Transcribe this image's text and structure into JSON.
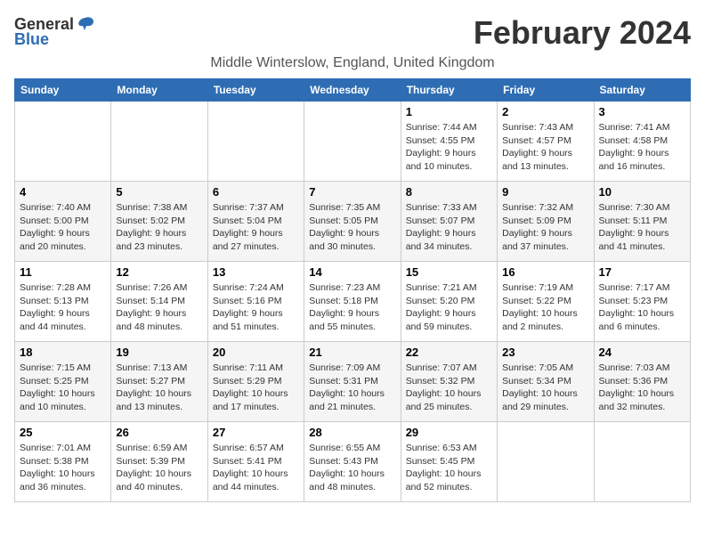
{
  "app": {
    "logo_general": "General",
    "logo_blue": "Blue"
  },
  "header": {
    "month_title": "February 2024",
    "location": "Middle Winterslow, England, United Kingdom"
  },
  "weekdays": [
    "Sunday",
    "Monday",
    "Tuesday",
    "Wednesday",
    "Thursday",
    "Friday",
    "Saturday"
  ],
  "weeks": [
    [
      {
        "day": "",
        "sunrise": "",
        "sunset": "",
        "daylight": ""
      },
      {
        "day": "",
        "sunrise": "",
        "sunset": "",
        "daylight": ""
      },
      {
        "day": "",
        "sunrise": "",
        "sunset": "",
        "daylight": ""
      },
      {
        "day": "",
        "sunrise": "",
        "sunset": "",
        "daylight": ""
      },
      {
        "day": "1",
        "sunrise": "Sunrise: 7:44 AM",
        "sunset": "Sunset: 4:55 PM",
        "daylight": "Daylight: 9 hours and 10 minutes."
      },
      {
        "day": "2",
        "sunrise": "Sunrise: 7:43 AM",
        "sunset": "Sunset: 4:57 PM",
        "daylight": "Daylight: 9 hours and 13 minutes."
      },
      {
        "day": "3",
        "sunrise": "Sunrise: 7:41 AM",
        "sunset": "Sunset: 4:58 PM",
        "daylight": "Daylight: 9 hours and 16 minutes."
      }
    ],
    [
      {
        "day": "4",
        "sunrise": "Sunrise: 7:40 AM",
        "sunset": "Sunset: 5:00 PM",
        "daylight": "Daylight: 9 hours and 20 minutes."
      },
      {
        "day": "5",
        "sunrise": "Sunrise: 7:38 AM",
        "sunset": "Sunset: 5:02 PM",
        "daylight": "Daylight: 9 hours and 23 minutes."
      },
      {
        "day": "6",
        "sunrise": "Sunrise: 7:37 AM",
        "sunset": "Sunset: 5:04 PM",
        "daylight": "Daylight: 9 hours and 27 minutes."
      },
      {
        "day": "7",
        "sunrise": "Sunrise: 7:35 AM",
        "sunset": "Sunset: 5:05 PM",
        "daylight": "Daylight: 9 hours and 30 minutes."
      },
      {
        "day": "8",
        "sunrise": "Sunrise: 7:33 AM",
        "sunset": "Sunset: 5:07 PM",
        "daylight": "Daylight: 9 hours and 34 minutes."
      },
      {
        "day": "9",
        "sunrise": "Sunrise: 7:32 AM",
        "sunset": "Sunset: 5:09 PM",
        "daylight": "Daylight: 9 hours and 37 minutes."
      },
      {
        "day": "10",
        "sunrise": "Sunrise: 7:30 AM",
        "sunset": "Sunset: 5:11 PM",
        "daylight": "Daylight: 9 hours and 41 minutes."
      }
    ],
    [
      {
        "day": "11",
        "sunrise": "Sunrise: 7:28 AM",
        "sunset": "Sunset: 5:13 PM",
        "daylight": "Daylight: 9 hours and 44 minutes."
      },
      {
        "day": "12",
        "sunrise": "Sunrise: 7:26 AM",
        "sunset": "Sunset: 5:14 PM",
        "daylight": "Daylight: 9 hours and 48 minutes."
      },
      {
        "day": "13",
        "sunrise": "Sunrise: 7:24 AM",
        "sunset": "Sunset: 5:16 PM",
        "daylight": "Daylight: 9 hours and 51 minutes."
      },
      {
        "day": "14",
        "sunrise": "Sunrise: 7:23 AM",
        "sunset": "Sunset: 5:18 PM",
        "daylight": "Daylight: 9 hours and 55 minutes."
      },
      {
        "day": "15",
        "sunrise": "Sunrise: 7:21 AM",
        "sunset": "Sunset: 5:20 PM",
        "daylight": "Daylight: 9 hours and 59 minutes."
      },
      {
        "day": "16",
        "sunrise": "Sunrise: 7:19 AM",
        "sunset": "Sunset: 5:22 PM",
        "daylight": "Daylight: 10 hours and 2 minutes."
      },
      {
        "day": "17",
        "sunrise": "Sunrise: 7:17 AM",
        "sunset": "Sunset: 5:23 PM",
        "daylight": "Daylight: 10 hours and 6 minutes."
      }
    ],
    [
      {
        "day": "18",
        "sunrise": "Sunrise: 7:15 AM",
        "sunset": "Sunset: 5:25 PM",
        "daylight": "Daylight: 10 hours and 10 minutes."
      },
      {
        "day": "19",
        "sunrise": "Sunrise: 7:13 AM",
        "sunset": "Sunset: 5:27 PM",
        "daylight": "Daylight: 10 hours and 13 minutes."
      },
      {
        "day": "20",
        "sunrise": "Sunrise: 7:11 AM",
        "sunset": "Sunset: 5:29 PM",
        "daylight": "Daylight: 10 hours and 17 minutes."
      },
      {
        "day": "21",
        "sunrise": "Sunrise: 7:09 AM",
        "sunset": "Sunset: 5:31 PM",
        "daylight": "Daylight: 10 hours and 21 minutes."
      },
      {
        "day": "22",
        "sunrise": "Sunrise: 7:07 AM",
        "sunset": "Sunset: 5:32 PM",
        "daylight": "Daylight: 10 hours and 25 minutes."
      },
      {
        "day": "23",
        "sunrise": "Sunrise: 7:05 AM",
        "sunset": "Sunset: 5:34 PM",
        "daylight": "Daylight: 10 hours and 29 minutes."
      },
      {
        "day": "24",
        "sunrise": "Sunrise: 7:03 AM",
        "sunset": "Sunset: 5:36 PM",
        "daylight": "Daylight: 10 hours and 32 minutes."
      }
    ],
    [
      {
        "day": "25",
        "sunrise": "Sunrise: 7:01 AM",
        "sunset": "Sunset: 5:38 PM",
        "daylight": "Daylight: 10 hours and 36 minutes."
      },
      {
        "day": "26",
        "sunrise": "Sunrise: 6:59 AM",
        "sunset": "Sunset: 5:39 PM",
        "daylight": "Daylight: 10 hours and 40 minutes."
      },
      {
        "day": "27",
        "sunrise": "Sunrise: 6:57 AM",
        "sunset": "Sunset: 5:41 PM",
        "daylight": "Daylight: 10 hours and 44 minutes."
      },
      {
        "day": "28",
        "sunrise": "Sunrise: 6:55 AM",
        "sunset": "Sunset: 5:43 PM",
        "daylight": "Daylight: 10 hours and 48 minutes."
      },
      {
        "day": "29",
        "sunrise": "Sunrise: 6:53 AM",
        "sunset": "Sunset: 5:45 PM",
        "daylight": "Daylight: 10 hours and 52 minutes."
      },
      {
        "day": "",
        "sunrise": "",
        "sunset": "",
        "daylight": ""
      },
      {
        "day": "",
        "sunrise": "",
        "sunset": "",
        "daylight": ""
      }
    ]
  ]
}
